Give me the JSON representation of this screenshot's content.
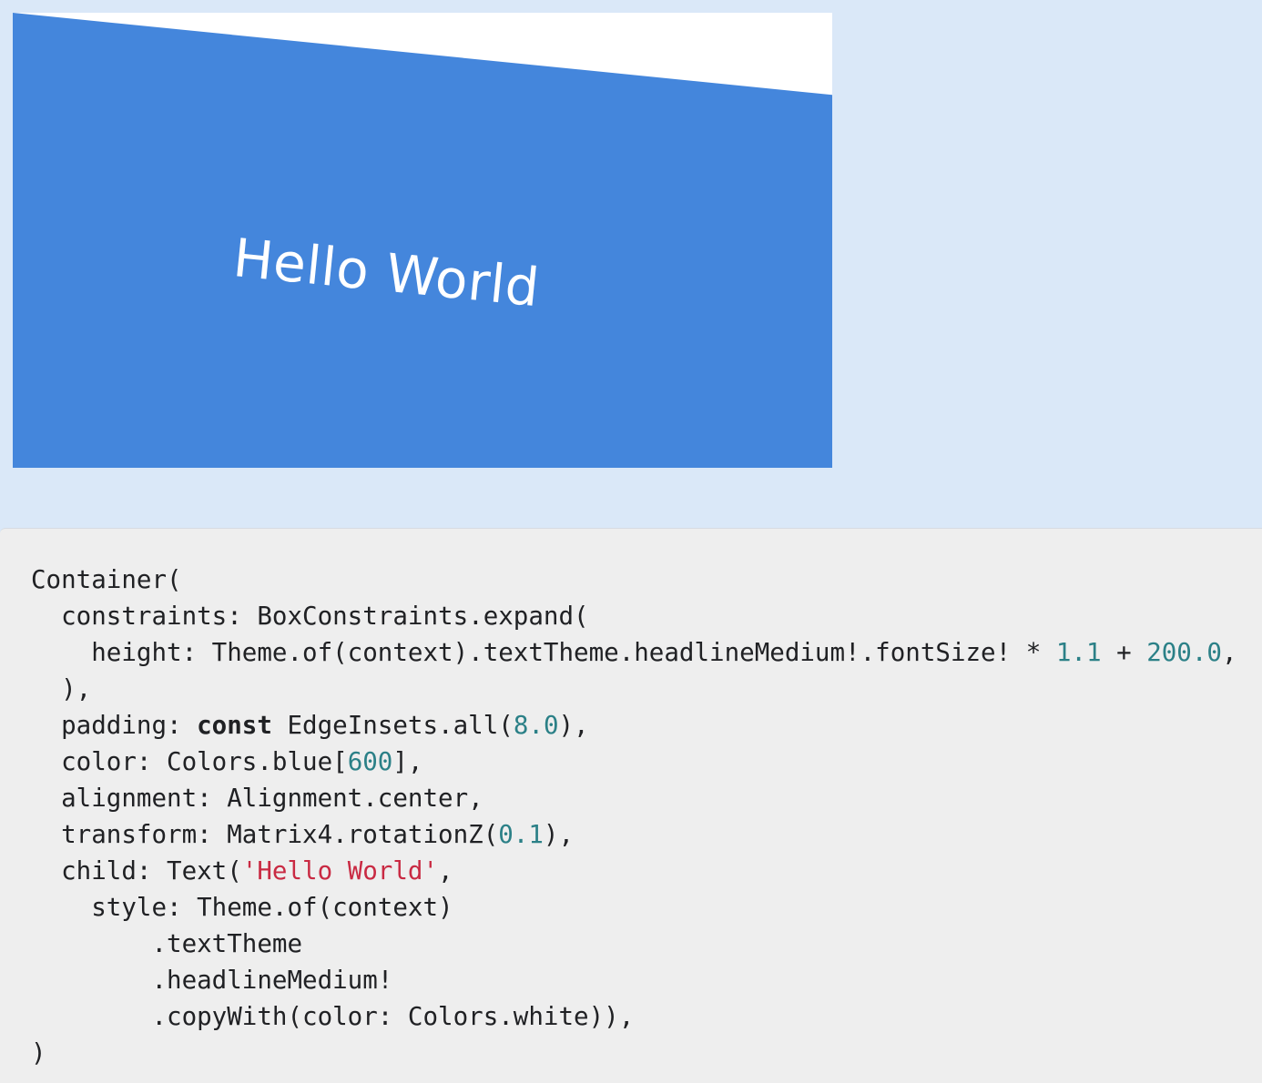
{
  "preview": {
    "text": "Hello World",
    "container_color": "#4486dc",
    "text_color": "#ffffff",
    "background_color": "#ffffff"
  },
  "code": {
    "line1": "Container(",
    "line2": "  constraints: BoxConstraints.expand(",
    "line3_prefix": "    height: Theme.of(context).textTheme.headlineMedium!.fontSize! * ",
    "line3_num1": "1.1",
    "line3_mid": " + ",
    "line3_num2": "200.0",
    "line3_suffix": ",",
    "line4": "  ),",
    "line5_prefix": "  padding: ",
    "line5_keyword": "const",
    "line5_mid": " EdgeInsets.all(",
    "line5_num": "8.0",
    "line5_suffix": "),",
    "line6_prefix": "  color: Colors.blue[",
    "line6_num": "600",
    "line6_suffix": "],",
    "line7": "  alignment: Alignment.center,",
    "line8_prefix": "  transform: Matrix4.rotationZ(",
    "line8_num": "0.1",
    "line8_suffix": "),",
    "line9_prefix": "  child: Text(",
    "line9_string": "'Hello World'",
    "line9_suffix": ",",
    "line10": "    style: Theme.of(context)",
    "line11": "        .textTheme",
    "line12": "        .headlineMedium!",
    "line13": "        .copyWith(color: Colors.white)),",
    "line14": ")"
  },
  "colors": {
    "page_background": "#dae8f8",
    "code_background": "#eeeeee",
    "number_literal": "#2b8087",
    "string_literal": "#c92a43"
  }
}
